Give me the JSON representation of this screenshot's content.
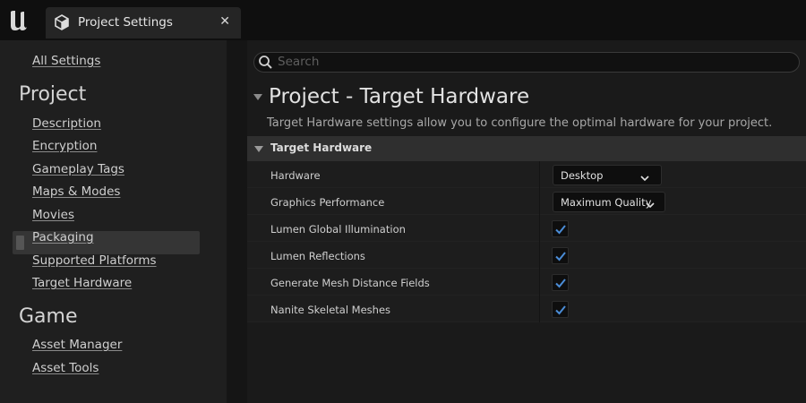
{
  "app": {
    "tab_title": "Project Settings",
    "tab_close": "✕"
  },
  "search": {
    "placeholder": "Search",
    "value": ""
  },
  "sidebar": {
    "all_settings": "All Settings",
    "categories": [
      {
        "heading": "Project",
        "items": [
          {
            "label": "Description"
          },
          {
            "label": "Encryption"
          },
          {
            "label": "Gameplay Tags"
          },
          {
            "label": "Maps & Modes"
          },
          {
            "label": "Movies"
          },
          {
            "label": "Packaging"
          },
          {
            "label": "Supported Platforms"
          },
          {
            "label": "Target Hardware",
            "selected": true
          }
        ]
      },
      {
        "heading": "Game",
        "items": [
          {
            "label": "Asset Manager"
          },
          {
            "label": "Asset Tools"
          }
        ]
      }
    ]
  },
  "page": {
    "title": "Project - Target Hardware",
    "description": "Target Hardware settings allow you to configure the optimal hardware for your project."
  },
  "section": {
    "label": "Target Hardware",
    "properties": [
      {
        "label": "Hardware",
        "type": "dropdown",
        "value": "Desktop"
      },
      {
        "label": "Graphics Performance",
        "type": "dropdown",
        "value": "Maximum Quality"
      },
      {
        "label": "Lumen Global Illumination",
        "type": "checkbox",
        "checked": true
      },
      {
        "label": "Lumen Reflections",
        "type": "checkbox",
        "checked": true
      },
      {
        "label": "Generate Mesh Distance Fields",
        "type": "checkbox",
        "checked": true
      },
      {
        "label": "Nanite Skeletal Meshes",
        "type": "checkbox",
        "checked": true
      }
    ]
  },
  "colors": {
    "checkbox_check": "#4a8cd6",
    "selected_item_bg": "#353535",
    "section_header_bg": "#2f2f2f"
  },
  "icons": {
    "app_logo": "unreal-logo-icon",
    "tab_icon": "settings-cube-icon",
    "search": "search-icon",
    "dropdown": "chevron-down-icon",
    "check": "checkmark-icon"
  }
}
